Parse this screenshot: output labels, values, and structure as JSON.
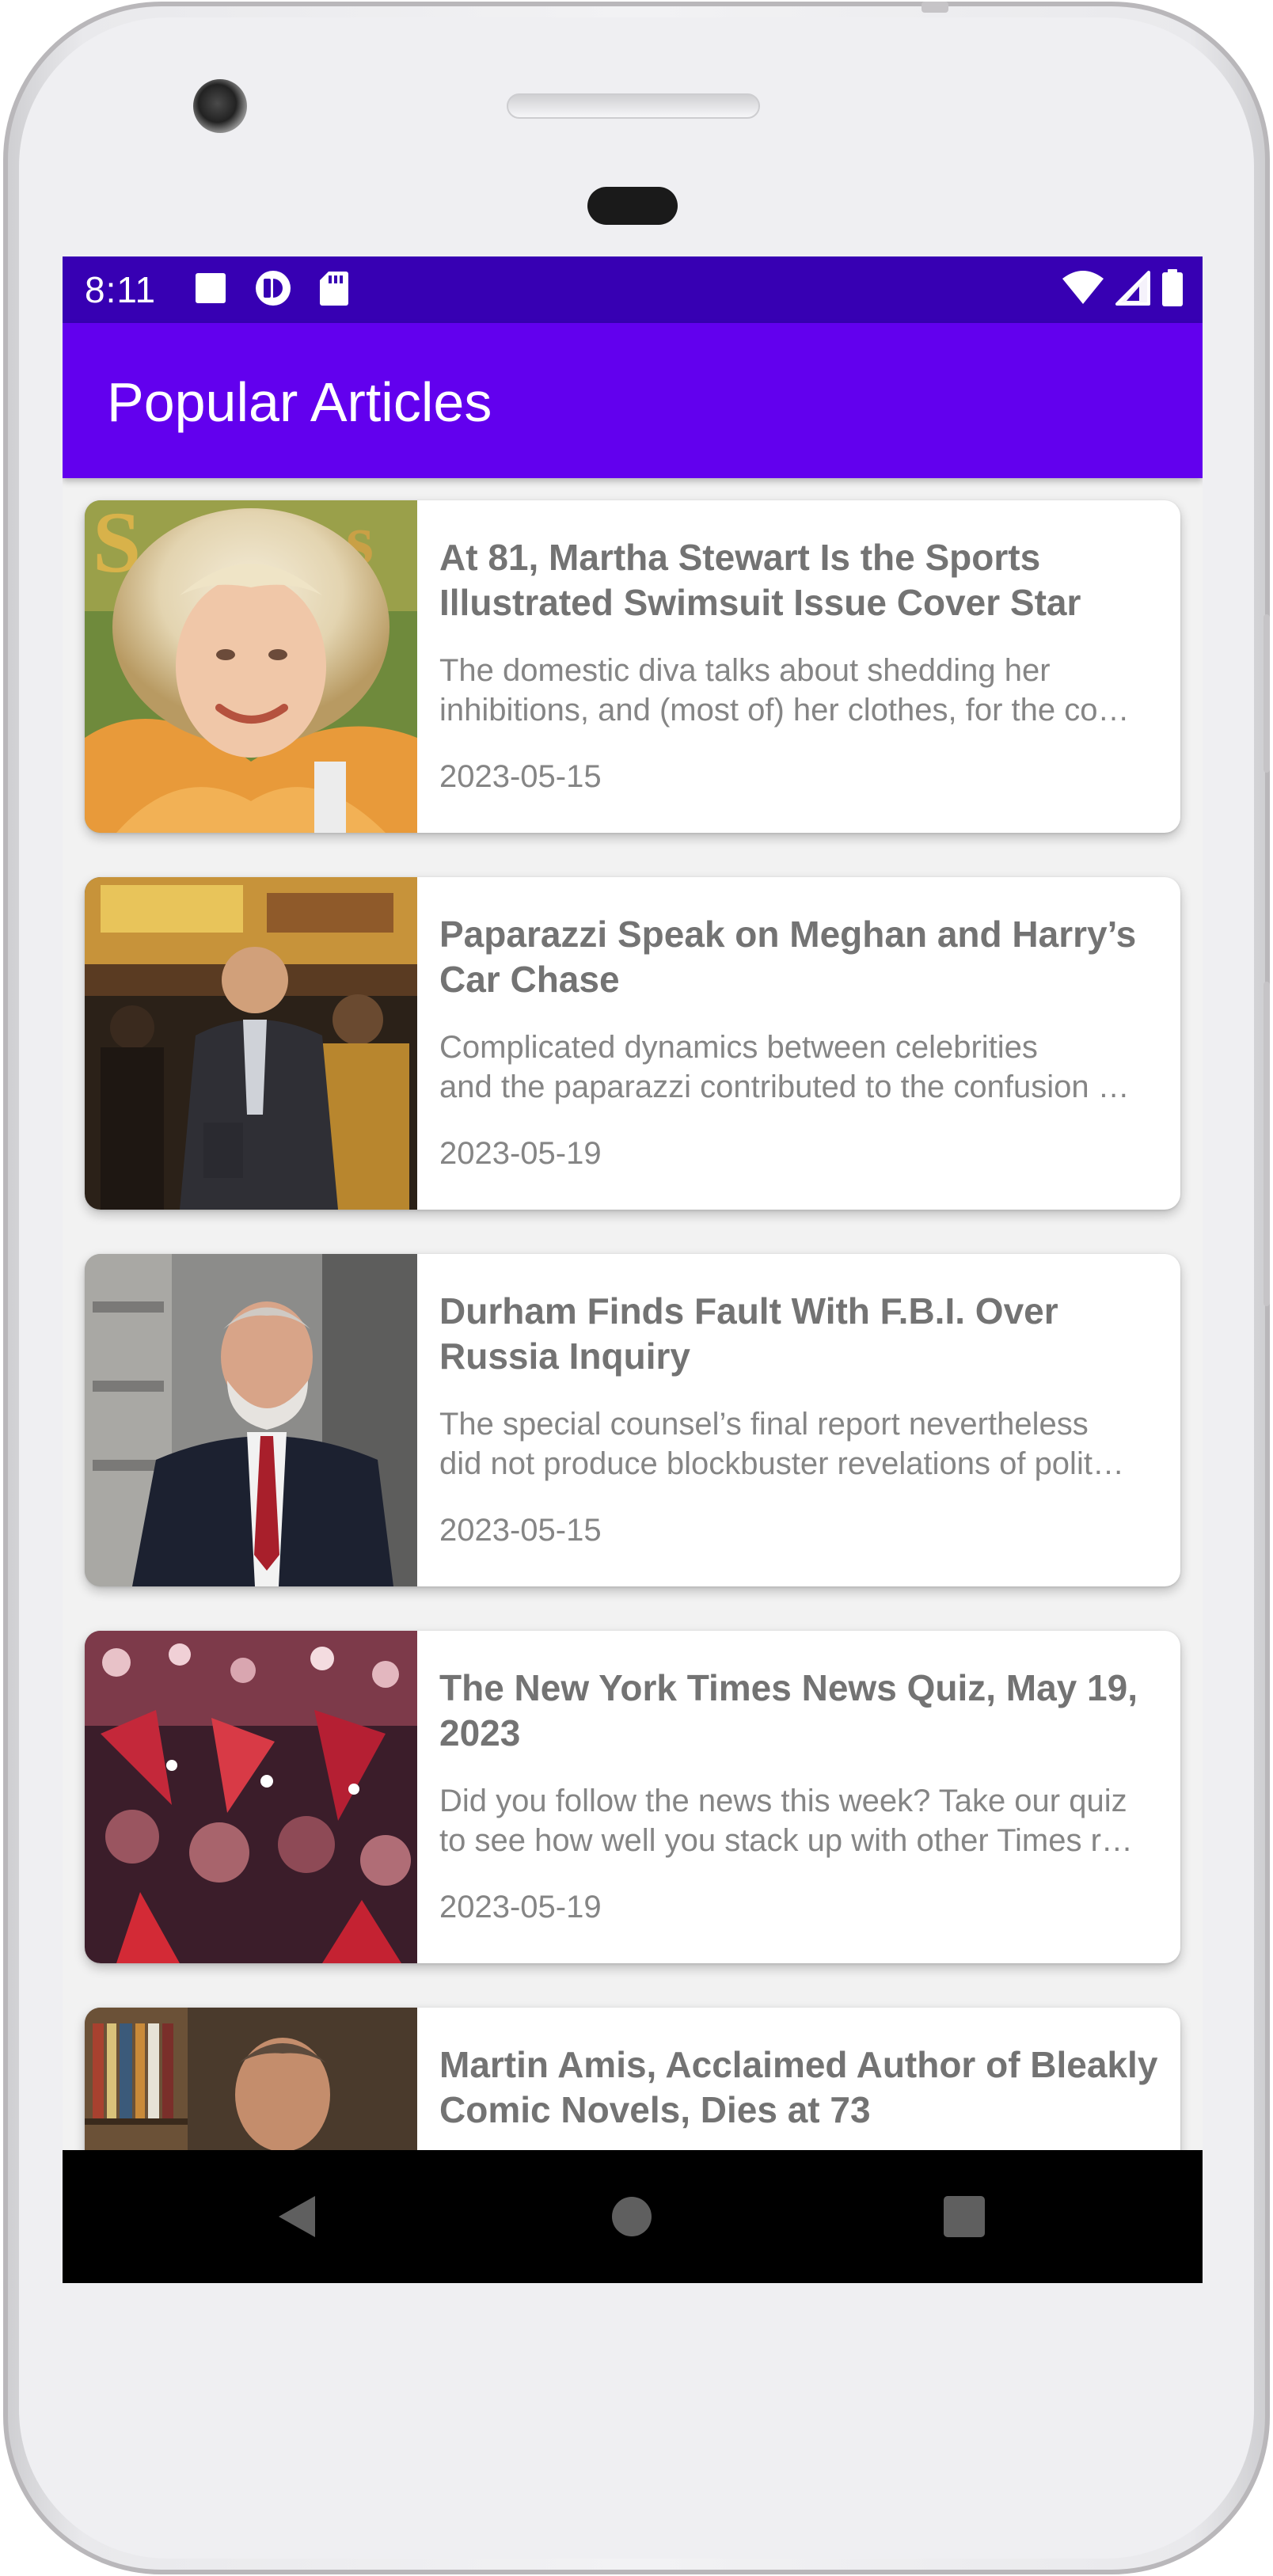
{
  "status_bar": {
    "time": "8:11",
    "left_icons": [
      "stop-notification-icon",
      "media-icon",
      "sd-card-icon"
    ],
    "right_icons": [
      "wifi-icon",
      "cell-signal-icon",
      "battery-icon"
    ]
  },
  "app_bar": {
    "title": "Popular Articles"
  },
  "articles": [
    {
      "title": "At 81, Martha Stewart Is the Sports Illustrated Swimsuit Issue Cover Star",
      "abstract_line1": "The domestic diva talks about shedding her",
      "abstract_line2": "inhibitions, and (most of) her clothes, for the co…",
      "date": "2023-05-15"
    },
    {
      "title": "Paparazzi Speak on Meghan and Harry’s Car Chase",
      "abstract_line1": "Complicated dynamics between celebrities",
      "abstract_line2": "and the paparazzi contributed to the confusion …",
      "date": "2023-05-19"
    },
    {
      "title": "Durham Finds Fault With F.B.I. Over Russia Inquiry",
      "abstract_line1": "The special counsel’s final report nevertheless",
      "abstract_line2": "did not produce blockbuster revelations of polit…",
      "date": "2023-05-15"
    },
    {
      "title": "The New York Times News Quiz, May 19, 2023",
      "abstract_line1": "Did you follow the news this week? Take our quiz",
      "abstract_line2": "to see how well you stack up with other Times r…",
      "date": "2023-05-19"
    },
    {
      "title": "Martin Amis, Acclaimed Author of Bleakly Comic Novels, Dies at 73",
      "abstract_line1": "",
      "abstract_line2": "",
      "date": ""
    }
  ],
  "nav_bar": {
    "buttons": [
      "back-icon",
      "home-icon",
      "recents-icon"
    ]
  },
  "colors": {
    "status_bar": "#3700b3",
    "app_bar": "#6200ee",
    "screen_background": "#f2f2f2",
    "card_title": "#737373",
    "card_secondary_text": "#858585"
  }
}
